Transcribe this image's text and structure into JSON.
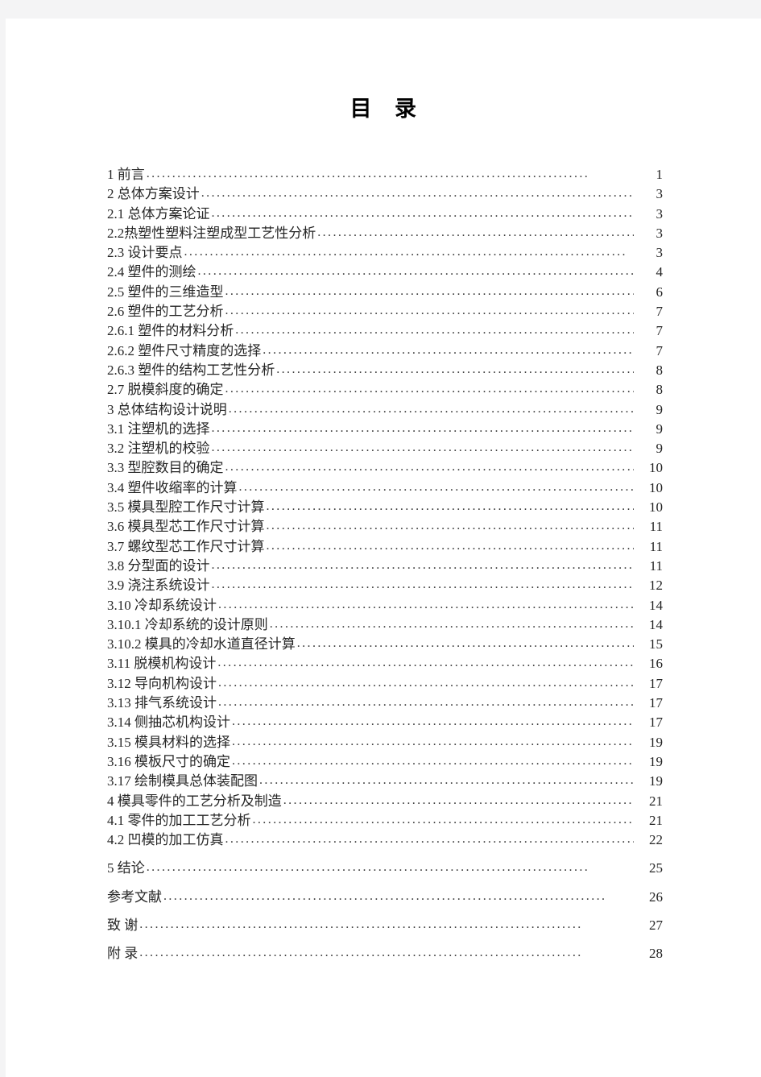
{
  "document": {
    "title_part_1": "目",
    "title_part_2": "录",
    "title_full": "目    录"
  },
  "toc": {
    "entries": [
      {
        "label": "1  前言",
        "page": "1"
      },
      {
        "label": "2 总体方案设计",
        "page": "3"
      },
      {
        "label": "2.1  总体方案论证",
        "page": "3"
      },
      {
        "label": "2.2热塑性塑料注塑成型工艺性分析",
        "page": "3"
      },
      {
        "label": "2.3 设计要点",
        "page": "3"
      },
      {
        "label": "2.4  塑件的测绘",
        "page": "4"
      },
      {
        "label": "2.5  塑件的三维造型",
        "page": "6"
      },
      {
        "label": "2.6  塑件的工艺分析",
        "page": "7"
      },
      {
        "label": "2.6.1 塑件的材料分析",
        "page": "7"
      },
      {
        "label": "2.6.2 塑件尺寸精度的选择",
        "page": "7"
      },
      {
        "label": "2.6.3 塑件的结构工艺性分析",
        "page": "8"
      },
      {
        "label": "2.7 脱模斜度的确定",
        "page": "8"
      },
      {
        "label": "3 总体结构设计说明",
        "page": "9"
      },
      {
        "label": "3.1 注塑机的选择",
        "page": "9"
      },
      {
        "label": "3.2 注塑机的校验",
        "page": "9"
      },
      {
        "label": "3.3 型腔数目的确定",
        "page": "10"
      },
      {
        "label": "3.4 塑件收缩率的计算",
        "page": "10"
      },
      {
        "label": "3.5 模具型腔工作尺寸计算",
        "page": "10"
      },
      {
        "label": "3.6 模具型芯工作尺寸计算",
        "page": "11"
      },
      {
        "label": "3.7 螺纹型芯工作尺寸计算",
        "page": "11"
      },
      {
        "label": "3.8 分型面的设计",
        "page": "11"
      },
      {
        "label": "3.9  浇注系统设计",
        "page": "12"
      },
      {
        "label": "3.10 冷却系统设计",
        "page": "14"
      },
      {
        "label": "3.10.1 冷却系统的设计原则",
        "page": "14"
      },
      {
        "label": "3.10.2 模具的冷却水道直径计算",
        "page": "15"
      },
      {
        "label": "3.11 脱模机构设计",
        "page": "16"
      },
      {
        "label": "3.12 导向机构设计",
        "page": "17"
      },
      {
        "label": "3.13 排气系统设计",
        "page": "17"
      },
      {
        "label": "3.14 侧抽芯机构设计",
        "page": "17"
      },
      {
        "label": "3.15 模具材料的选择",
        "page": "19"
      },
      {
        "label": "3.16 模板尺寸的确定",
        "page": "19"
      },
      {
        "label": "3.17 绘制模具总体装配图",
        "page": "19"
      },
      {
        "label": "4 模具零件的工艺分析及制造",
        "page": "21"
      },
      {
        "label": "4.1 零件的加工工艺分析",
        "page": "21"
      },
      {
        "label": "4.2 凹模的加工仿真",
        "page": "22"
      },
      {
        "label": "5  结论",
        "page": "25",
        "gap_before": true
      },
      {
        "label": "参考文献",
        "page": "26",
        "gap_before": true
      },
      {
        "label": "致      谢",
        "page": "27",
        "gap_before": true
      },
      {
        "label": "附      录",
        "page": "28",
        "gap_before": true
      }
    ]
  },
  "colors": {
    "page_background": "#ffffff",
    "canvas_background": "#f4f4f5",
    "text": "#262626",
    "title": "#000000"
  }
}
